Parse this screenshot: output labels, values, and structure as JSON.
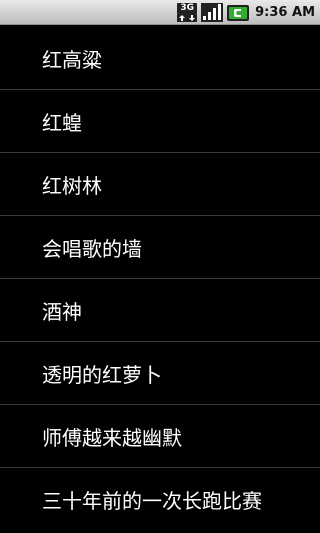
{
  "status_bar": {
    "network_type": "3G",
    "time": "9:36 AM",
    "icons": [
      "3g-data-icon",
      "signal-icon",
      "battery-icon"
    ]
  },
  "list": {
    "items": [
      {
        "label": "红高粱"
      },
      {
        "label": "红蝗"
      },
      {
        "label": "红树林"
      },
      {
        "label": "会唱歌的墙"
      },
      {
        "label": "酒神"
      },
      {
        "label": "透明的红萝卜"
      },
      {
        "label": "师傅越来越幽默"
      },
      {
        "label": "三十年前的一次长跑比赛"
      }
    ]
  }
}
